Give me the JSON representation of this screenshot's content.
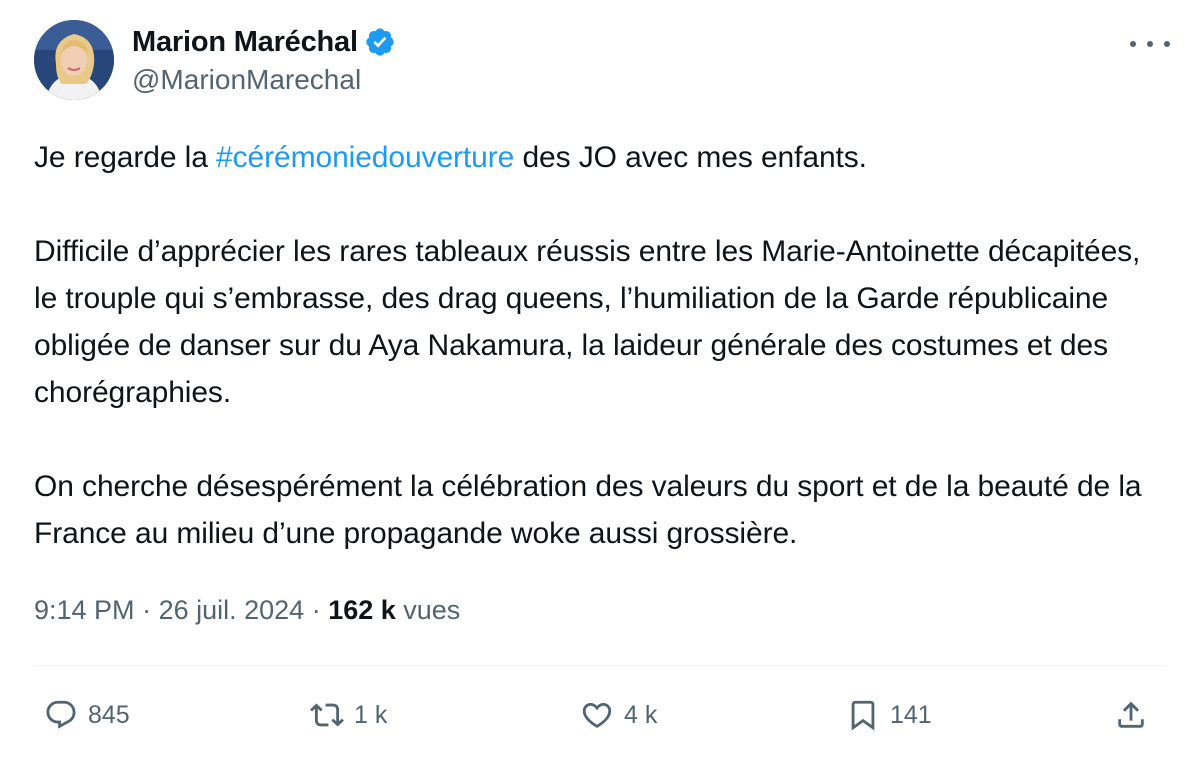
{
  "author": {
    "display_name": "Marion Maréchal",
    "handle": "@MarionMarechal",
    "verified": true
  },
  "tweet": {
    "line1_pre": "Je regarde la ",
    "hashtag": "#cérémoniedouverture",
    "line1_post": " des JO avec mes enfants.",
    "paragraph2": "Difficile d’apprécier les rares tableaux réussis entre les Marie-Antoinette décapitées, le trouple qui s’embrasse, des drag queens, l’humiliation de la Garde républicaine obligée de danser sur du Aya Nakamura, la laideur générale des costumes et des chorégraphies.",
    "paragraph3": "On cherche désespérément la célébration des valeurs du sport et de la beauté de la France au milieu d’une propagande woke aussi grossière."
  },
  "meta": {
    "time": "9:14 PM",
    "separator": " · ",
    "date": "26 juil. 2024",
    "views_count": "162 k",
    "views_label": " vues"
  },
  "actions": {
    "replies": "845",
    "reposts": "1 k",
    "likes": "4 k",
    "bookmarks": "141"
  },
  "colors": {
    "accent": "#1d9bf0",
    "secondary_text": "#536471",
    "primary_text": "#0f1419"
  },
  "icons": [
    "verified-badge-icon",
    "more-icon",
    "reply-icon",
    "repost-icon",
    "like-icon",
    "bookmark-icon",
    "share-icon"
  ]
}
